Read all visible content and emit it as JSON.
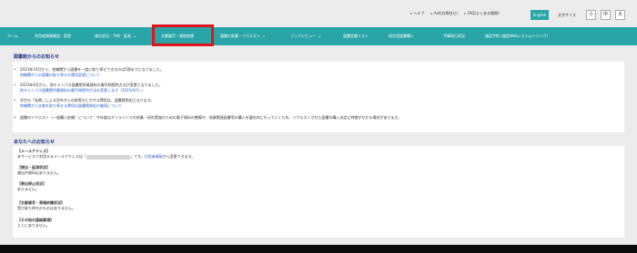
{
  "utility": {
    "links": [
      "ヘルプ",
      "Ask(お問合せ)",
      "FAQ(よくある質問)"
    ],
    "language_button": "English",
    "font_size_label": "文字サイズ",
    "font_sizes": [
      "小",
      "中",
      "大"
    ]
  },
  "nav": {
    "items": [
      "ホーム",
      "利用者情報確認・変更",
      "貸出状況・予約・延長",
      "文献複写・貸借依頼",
      "図書の推薦・リクエスト",
      "ブックレビュー",
      "図書定額リスト",
      "研究室図書購入",
      "予算執行状況",
      "施設予約 (施設Webシステムへリンク)"
    ]
  },
  "library_notices": {
    "title": "図書館からのお知らせ",
    "items": [
      {
        "text": "2023年10月から、他機関から図書を一度に取り寄せできるのは5冊までになりました。",
        "link": "他機関からの図書の取り寄せの運用変更について"
      },
      {
        "text": "2023年4月から、他キャンパス図書館所蔵資料の複写物提供方法が変更となりました。",
        "link": "他キャンパス図書館所蔵資料の複写物提供方法を変更します（2023/4/3~）"
      },
      {
        "text": "学生の「私費」による学外からの取寄せにかかる費用は、図書館負担となります。",
        "link": "他機関から文献を取り寄せる費用の図書館負担の継続について"
      },
      {
        "text": "図書のリクエスト（一般購入依頼）について：今年度はオンラインでの授業・研究実施のための電子資料の整備や、授業関連図書等の購入を優先的に行っていくため、リクエストされた図書の購入決定に時間がかかる場合があります。",
        "link": ""
      }
    ]
  },
  "user_notices": {
    "title": "あなたへのお知らせ",
    "sections": [
      {
        "heading": "【メールアドレス】",
        "text_before": "本サービスで利用するメールアドレスは「",
        "text_after": "」です。",
        "link": "利用者情報",
        "text_end": "から変更できます。"
      },
      {
        "heading": "【貸出・延滞状況】",
        "text": "貸出中資料はありません。"
      },
      {
        "heading": "【貸出停止状況】",
        "text": "ありません。"
      },
      {
        "heading": "【文献複写・貸借依頼状況】",
        "text": "受け取り待ちのものはありません。"
      },
      {
        "heading": "【その他の連絡事項】",
        "text": "とくにありません。"
      }
    ]
  },
  "colors": {
    "nav": "#2aa5a7",
    "highlight": "#e0141b",
    "link": "#2a5fc7",
    "title": "#1f3a8a"
  }
}
